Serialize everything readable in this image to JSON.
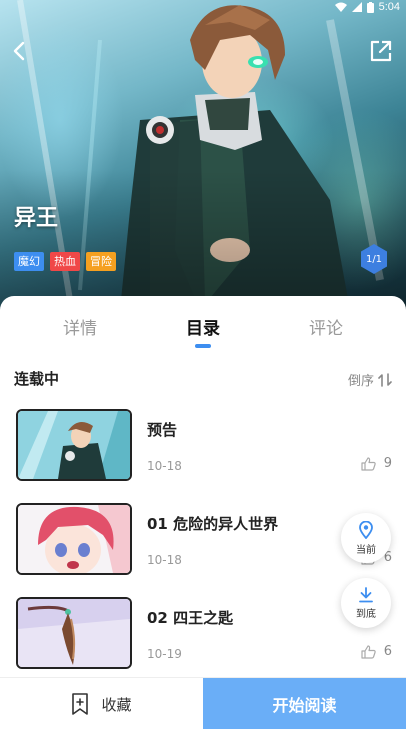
{
  "status_bar": {
    "time": "5:04"
  },
  "comic": {
    "title": "异王",
    "tags": [
      {
        "label": "魔幻",
        "color": "#3d8ef0"
      },
      {
        "label": "热血",
        "color": "#f04848"
      },
      {
        "label": "冒险",
        "color": "#f5a020"
      }
    ],
    "page_badge": "1/1"
  },
  "tabs": [
    {
      "label": "详情",
      "active": false
    },
    {
      "label": "目录",
      "active": true
    },
    {
      "label": "评论",
      "active": false
    }
  ],
  "catalog": {
    "status": "连载中",
    "sort_label": "倒序",
    "chapters": [
      {
        "title": "预告",
        "date": "10-18",
        "likes": "9"
      },
      {
        "title": "01 危险的异人世界",
        "date": "10-18",
        "likes": "6"
      },
      {
        "title": "02 四王之匙",
        "date": "10-19",
        "likes": "6"
      }
    ]
  },
  "floating": {
    "current_label": "当前",
    "bottom_label": "到底"
  },
  "bottom_bar": {
    "favorite_label": "收藏",
    "read_label": "开始阅读"
  },
  "colors": {
    "accent": "#3d8ef0",
    "read_button": "#6aaef7"
  }
}
